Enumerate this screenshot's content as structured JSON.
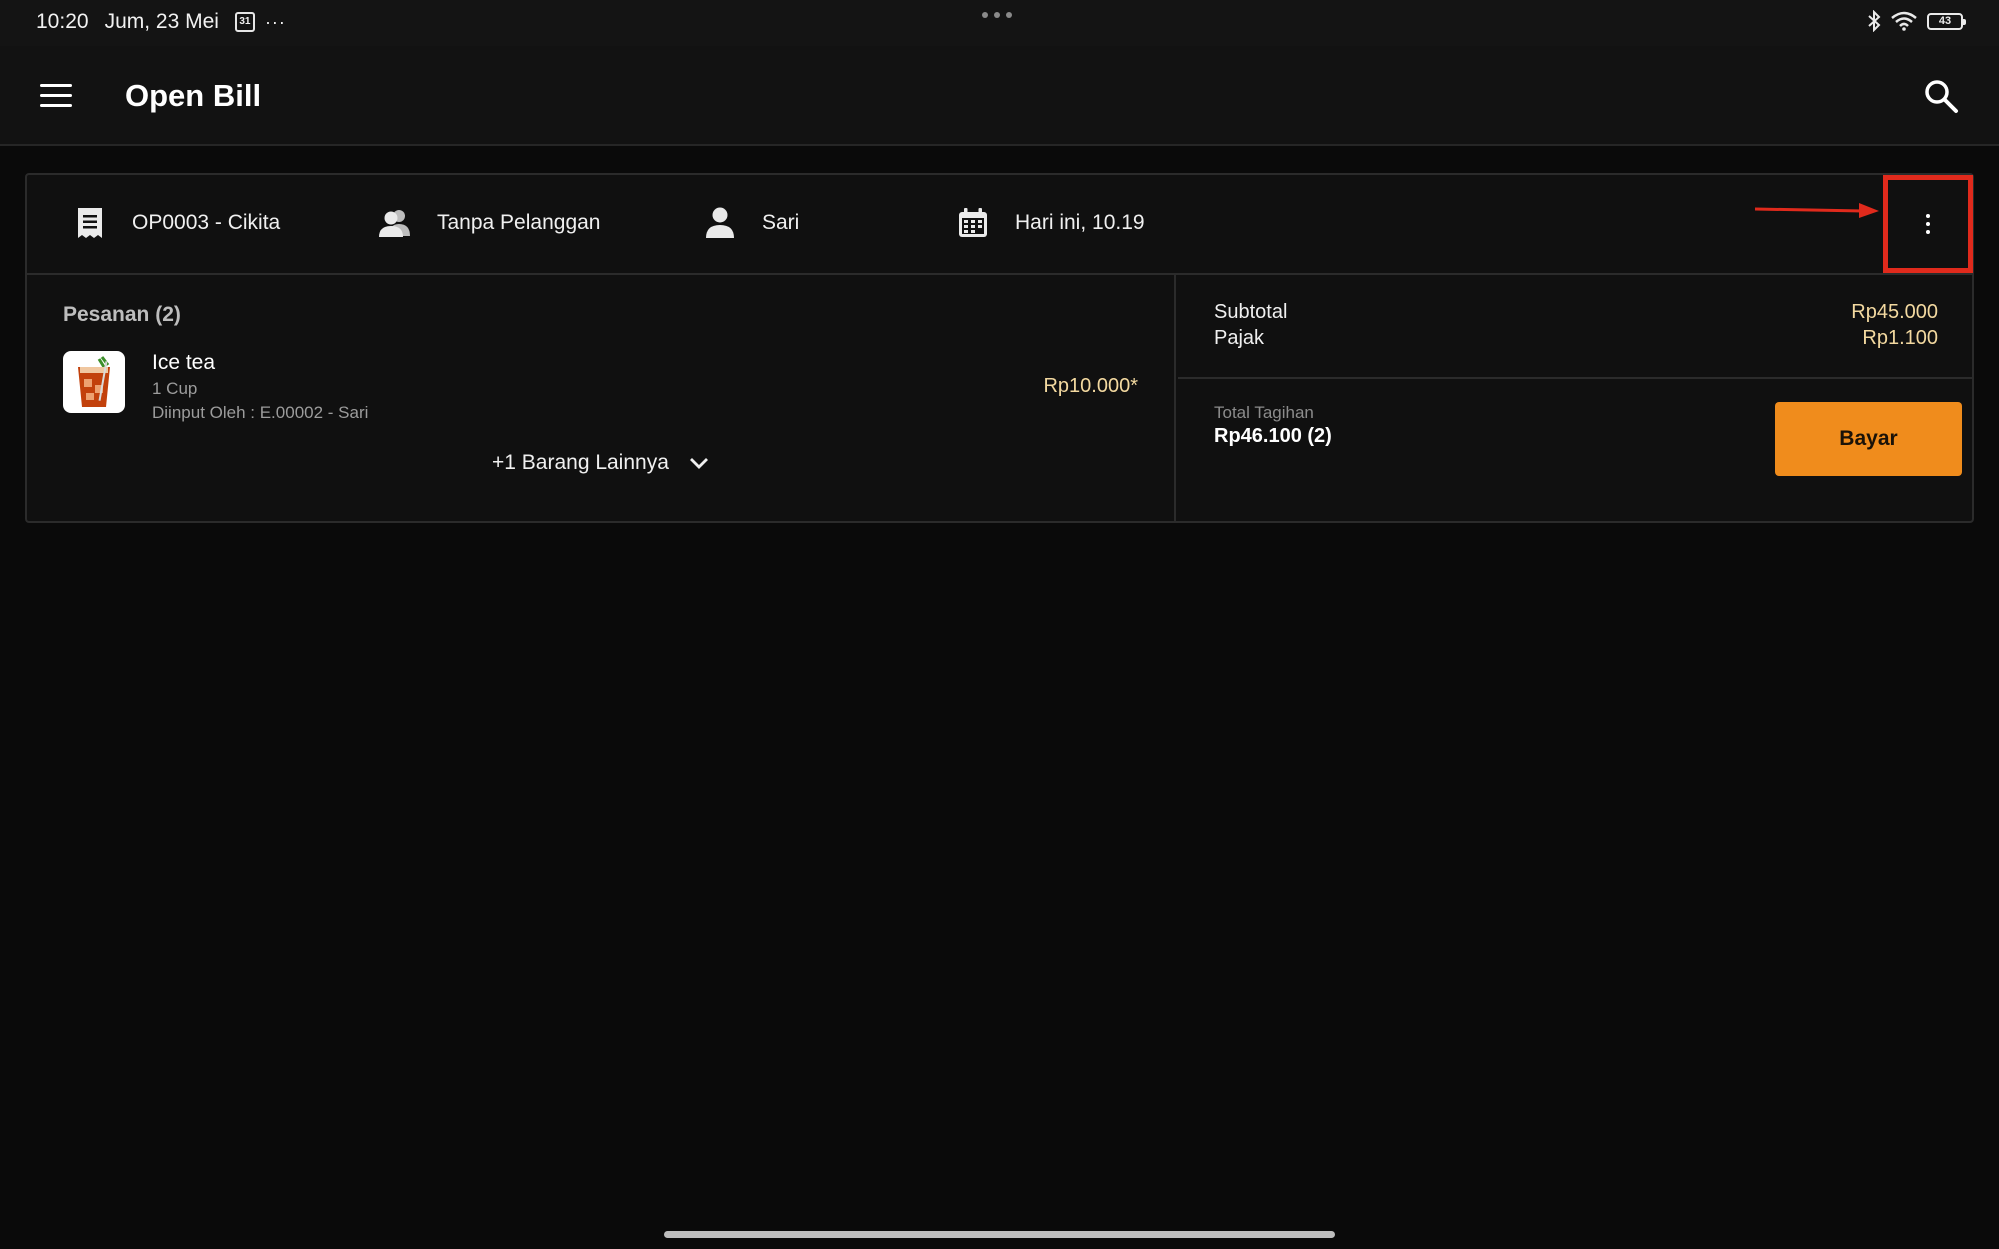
{
  "status_bar": {
    "time": "10:20",
    "date": "Jum, 23 Mei",
    "calendar_badge": "31",
    "more": "···",
    "battery": "43"
  },
  "app_bar": {
    "title": "Open Bill",
    "menu_icon": "hamburger-menu-icon",
    "search_icon": "search-icon"
  },
  "bill": {
    "bill_id": "OP0003 - Cikita",
    "customer": "Tanpa Pelanggan",
    "staff": "Sari",
    "datetime": "Hari ini, 10.19",
    "orders_title": "Pesanan (2)",
    "item": {
      "name": "Ice tea",
      "qty": "1 Cup",
      "entered_by": "Diinput Oleh : E.00002 - Sari",
      "price": "Rp10.000*"
    },
    "more_items": "+1 Barang Lainnya",
    "subtotal_label": "Subtotal",
    "subtotal_value": "Rp45.000",
    "tax_label": "Pajak",
    "tax_value": "Rp1.100",
    "total_label": "Total Tagihan",
    "total_value": "Rp46.100 (2)",
    "pay_label": "Bayar"
  },
  "colors": {
    "accent": "#f08c1c",
    "highlight_box": "#e02a1c",
    "price_text": "#f3d9a0"
  }
}
